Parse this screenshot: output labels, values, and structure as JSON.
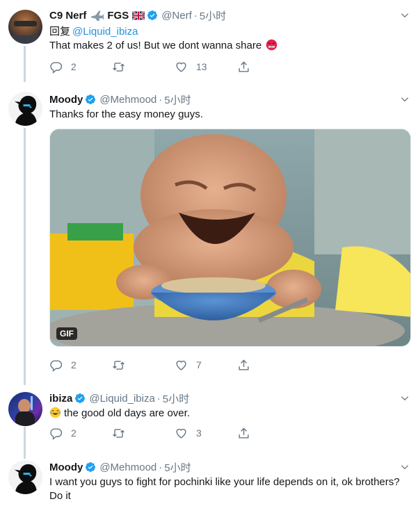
{
  "tweets": [
    {
      "name": "C9 Nerf",
      "name_extra": "FGS",
      "handle": "@Nerf",
      "time": "5小时",
      "replying_label": "回复",
      "replying_to": "@Liquid_ibiza",
      "text": "That makes 2 of us! But we dont wanna share",
      "emoji": "angry-face-emoji",
      "replies": "2",
      "retweets": "",
      "likes": "13"
    },
    {
      "name": "Moody",
      "handle": "@Mehmood",
      "time": "5小时",
      "text": "Thanks for the easy money guys.",
      "media_badge": "GIF",
      "replies": "2",
      "retweets": "",
      "likes": "7"
    },
    {
      "name": "ibiza",
      "handle": "@Liquid_ibiza",
      "time": "5小时",
      "emoji": "tears-of-joy-emoji",
      "text": "the good old days are over.",
      "replies": "2",
      "retweets": "",
      "likes": "3"
    },
    {
      "name": "Moody",
      "handle": "@Mehmood",
      "time": "5小时",
      "text": "I want you guys to fight for pochinki like your life depends on it, ok brothers? Do it"
    }
  ],
  "separator": "·",
  "colors": {
    "accent": "#1da1f2",
    "mention": "#1b95e0",
    "muted": "#657786",
    "thread": "#ccd6dd"
  }
}
